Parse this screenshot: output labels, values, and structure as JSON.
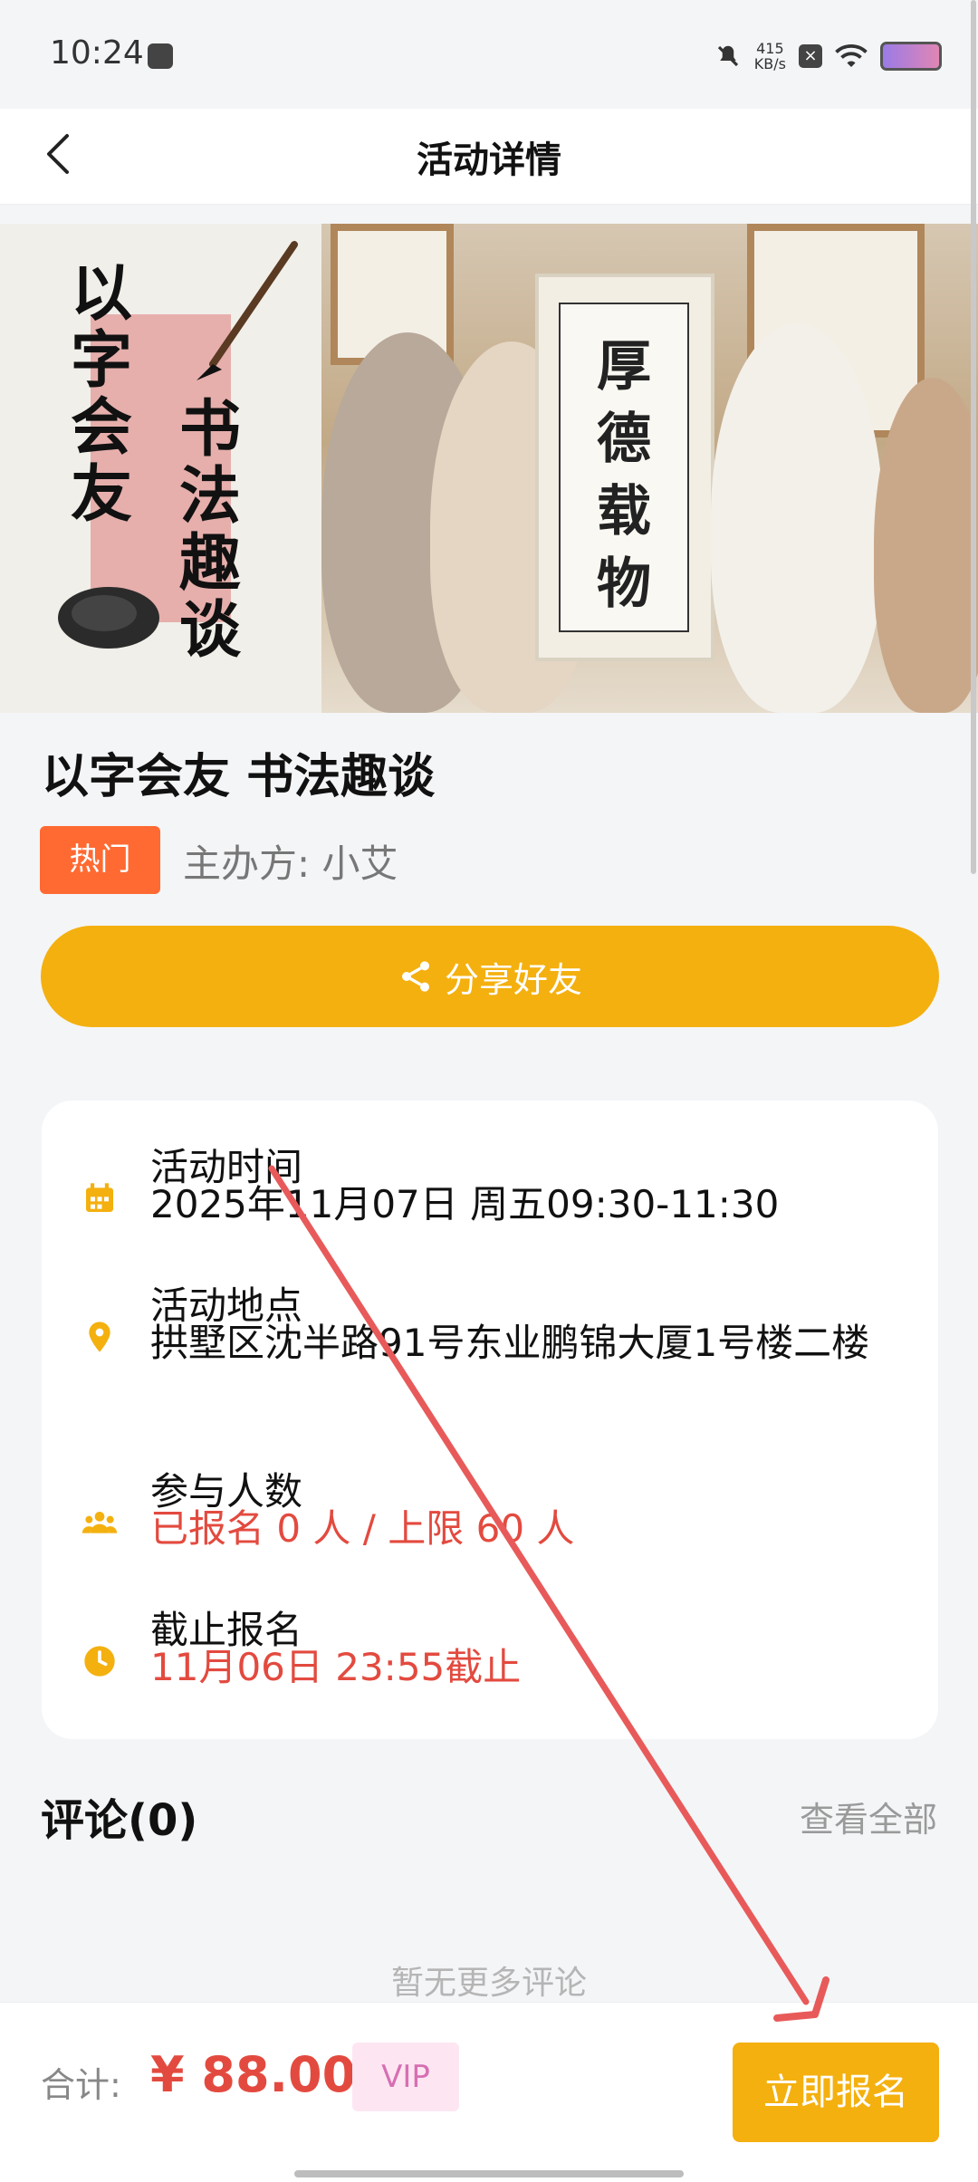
{
  "status_bar": {
    "time": "10:24",
    "speed": "415",
    "speed_unit": "KB/s"
  },
  "navbar": {
    "title": "活动详情"
  },
  "banner": {
    "left_col1": [
      "以",
      "字",
      "会",
      "友"
    ],
    "left_col2": [
      "书",
      "法",
      "趣",
      "谈"
    ],
    "scroll_chars": [
      "厚",
      "德",
      "载",
      "物"
    ]
  },
  "event": {
    "title": "以字会友 书法趣谈",
    "hot_tag": "热门",
    "organizer": "主办方: 小艾",
    "share_label": "分享好友"
  },
  "info": {
    "time_label": "活动时间",
    "time_value": "2025年11月07日 周五09:30-11:30",
    "place_label": "活动地点",
    "place_value": "拱墅区沈半路91号东业鹏锦大厦1号楼二楼",
    "people_label": "参与人数",
    "people_value": "已报名 0 人 / 上限 60 人",
    "deadline_label": "截止报名",
    "deadline_value": "11月06日 23:55截止"
  },
  "comments": {
    "title": "评论(0)",
    "view_all": "查看全部",
    "empty": "暂无更多评论"
  },
  "bottom": {
    "total_label": "合计:",
    "price": "¥ 88.00",
    "vip": "VIP",
    "signup": "立即报名"
  },
  "colors": {
    "accent": "#f4b00f",
    "hot": "#ff6a32",
    "price": "#e34a3f",
    "vip_bg": "#fde6f2",
    "annotation_arrow": "#e85a5a"
  }
}
